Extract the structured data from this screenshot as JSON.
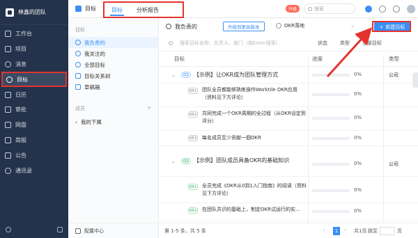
{
  "sidebar": {
    "team_name": "林鑫的团队",
    "items": [
      {
        "label": "工作台",
        "icon": "workbench-icon"
      },
      {
        "label": "项目",
        "icon": "project-icon"
      },
      {
        "label": "消息",
        "icon": "message-icon"
      },
      {
        "label": "目标",
        "icon": "target-icon",
        "active": true
      },
      {
        "label": "日历",
        "icon": "calendar-icon"
      },
      {
        "label": "审批",
        "icon": "approval-icon"
      },
      {
        "label": "网盘",
        "icon": "drive-icon"
      },
      {
        "label": "简报",
        "icon": "report-icon"
      },
      {
        "label": "公告",
        "icon": "announcement-icon"
      },
      {
        "label": "通讯录",
        "icon": "contacts-icon"
      }
    ]
  },
  "topbar": {
    "app_title": "目标",
    "tabs": [
      {
        "label": "目标",
        "active": true
      },
      {
        "label": "分析报告"
      }
    ],
    "upgrade_badge": "升级",
    "search_placeholder": "搜索"
  },
  "subnav": {
    "section_label": "目标",
    "items": [
      {
        "label": "我负责的",
        "active": true
      },
      {
        "label": "我关注的"
      },
      {
        "label": "全部目标"
      },
      {
        "label": "目标关系树"
      },
      {
        "label": "草稿箱"
      }
    ],
    "members_label": "成员",
    "members_add": "+",
    "subordinates": "我的下属",
    "footer": "配置中心"
  },
  "main": {
    "title": "我负责的",
    "upgrade_button": "升级到更高版本",
    "okr_select": "OKR落地",
    "new_button": "新建目标",
    "search_placeholder": "搜索目标名称、负责人、部门（按Enter搜索）",
    "filters": [
      "状态",
      "类型",
      "全部目标"
    ],
    "columns": {
      "goal": "目标",
      "progress": "进度",
      "type": "类型"
    },
    "rows": [
      {
        "kind": "O",
        "badge": "O1",
        "text": "【示例】让OKR成为团队管理方式",
        "pct": "0%",
        "type": "公司"
      },
      {
        "kind": "KR",
        "badge": "KR1",
        "text": "团队全员都能够熟练操作Worktile OKR应用（资料见下方评论）",
        "pct": "0%"
      },
      {
        "kind": "KR",
        "badge": "KR2",
        "text": "共同完成一个OKR周期的全过程（从OKR设定到评分）",
        "pct": "0%"
      },
      {
        "kind": "KR",
        "badge": "KR3",
        "text": "每名成员至少贡献一個OKR",
        "pct": "0%"
      },
      {
        "kind": "O",
        "badge": "O2",
        "text": "【示例】团队成员具备OKR的基础知识",
        "pct": "0%",
        "type": "公司"
      },
      {
        "kind": "KR",
        "badge": "KR1",
        "text": "全员完成《OKR从0到1入门指南》的阅读（资料见下方评论）",
        "pct": "0%"
      },
      {
        "kind": "KR",
        "badge": "KR2",
        "text": "在团队共识的基础上，制定OKR试运行的实...",
        "pct": "0%"
      }
    ],
    "pager": {
      "info_prefix": "第",
      "info_range": "1-5",
      "info_mid": "条，共",
      "info_total": "5",
      "info_suffix": "条",
      "current": "1",
      "total_pages": "共1页",
      "jump": "跳至",
      "page": "页"
    }
  },
  "colors": {
    "accent": "#3b8ef5",
    "annotation": "#e4332e",
    "nav_bg": "#24334b"
  }
}
